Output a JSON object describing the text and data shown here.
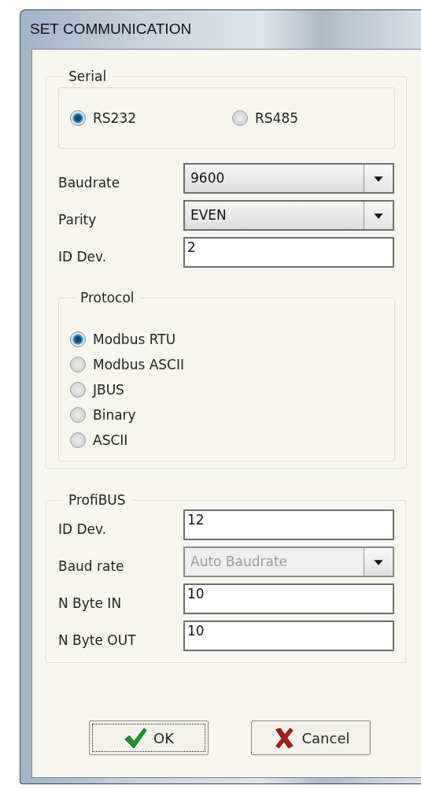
{
  "window": {
    "title": "SET COMMUNICATION"
  },
  "serial": {
    "title": "Serial",
    "interfaces": [
      {
        "label": "RS232",
        "selected": true
      },
      {
        "label": "RS485",
        "selected": false
      }
    ],
    "fields": [
      {
        "kind": "dropdown",
        "label": "Baudrate",
        "value": "9600",
        "disabled": false
      },
      {
        "kind": "dropdown",
        "label": "Parity",
        "value": "EVEN",
        "disabled": false
      },
      {
        "kind": "text",
        "label": "ID Dev.",
        "value": "2"
      }
    ],
    "protocol": {
      "title": "Protocol",
      "options": [
        {
          "label": "Modbus RTU",
          "selected": true
        },
        {
          "label": "Modbus ASCII",
          "selected": false
        },
        {
          "label": "JBUS",
          "selected": false
        },
        {
          "label": "Binary",
          "selected": false
        },
        {
          "label": "ASCII",
          "selected": false
        }
      ]
    }
  },
  "profibus": {
    "title": "ProfiBUS",
    "fields": [
      {
        "kind": "text",
        "label": "ID Dev.",
        "value": "12"
      },
      {
        "kind": "dropdown",
        "label": "Baud rate",
        "value": "Auto Baudrate",
        "disabled": true
      },
      {
        "kind": "text",
        "label": "N Byte IN",
        "value": "10"
      },
      {
        "kind": "text",
        "label": "N Byte OUT",
        "value": "10"
      }
    ]
  },
  "buttons": [
    {
      "kind": "ok",
      "label": "OK",
      "focused": true
    },
    {
      "kind": "cancel",
      "label": "Cancel",
      "focused": false
    }
  ]
}
